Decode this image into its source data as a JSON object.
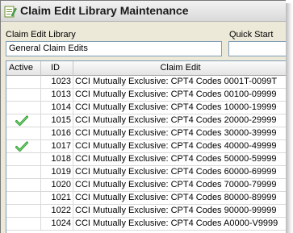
{
  "window": {
    "title": "Claim Edit Library Maintenance",
    "icon": "edit-library-icon"
  },
  "form": {
    "library_label": "Claim Edit Library",
    "library_value": "General Claim Edits",
    "quick_start_label": "Quick Start",
    "quick_start_value": ""
  },
  "grid": {
    "columns": [
      "Active",
      "ID",
      "Claim Edit"
    ],
    "check_icon": "checkmark-icon",
    "check_color": "#2e9a2e",
    "rows": [
      {
        "active": false,
        "id": "1023",
        "edit": "CCI Mutually Exclusive: CPT4 Codes 0001T-0099T"
      },
      {
        "active": false,
        "id": "1013",
        "edit": "CCI Mutually Exclusive: CPT4 Codes 00100-09999"
      },
      {
        "active": false,
        "id": "1014",
        "edit": "CCI Mutually Exclusive: CPT4 Codes 10000-19999"
      },
      {
        "active": true,
        "id": "1015",
        "edit": "CCI Mutually Exclusive: CPT4 Codes 20000-29999"
      },
      {
        "active": false,
        "id": "1016",
        "edit": "CCI Mutually Exclusive: CPT4 Codes 30000-39999"
      },
      {
        "active": true,
        "id": "1017",
        "edit": "CCI Mutually Exclusive: CPT4 Codes 40000-49999"
      },
      {
        "active": false,
        "id": "1018",
        "edit": "CCI Mutually Exclusive: CPT4 Codes 50000-59999"
      },
      {
        "active": false,
        "id": "1019",
        "edit": "CCI Mutually Exclusive: CPT4 Codes 60000-69999"
      },
      {
        "active": false,
        "id": "1020",
        "edit": "CCI Mutually Exclusive: CPT4 Codes 70000-79999"
      },
      {
        "active": false,
        "id": "1021",
        "edit": "CCI Mutually Exclusive: CPT4 Codes 80000-89999"
      },
      {
        "active": false,
        "id": "1022",
        "edit": "CCI Mutually Exclusive: CPT4 Codes 90000-99999"
      },
      {
        "active": false,
        "id": "1024",
        "edit": "CCI Mutually Exclusive: CPT4 Codes A0000-V9999"
      }
    ]
  }
}
